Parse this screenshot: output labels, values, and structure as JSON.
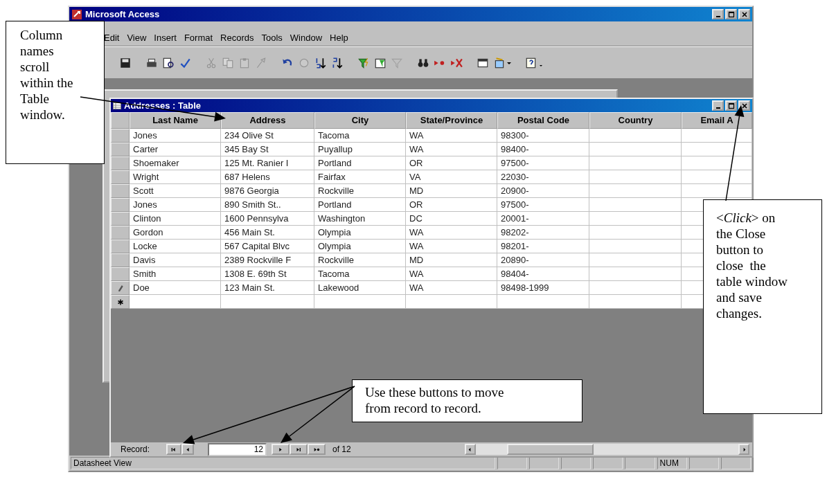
{
  "app_window": {
    "title": "Microsoft Access"
  },
  "menu_bar": [
    "Edit",
    "View",
    "Insert",
    "Format",
    "Records",
    "Tools",
    "Window",
    "Help"
  ],
  "table_window": {
    "title": "Addresses : Table",
    "columns": [
      "Last Name",
      "Address",
      "City",
      "State/Province",
      "Postal Code",
      "Country",
      "Email A"
    ],
    "rows": [
      {
        "kind": "record",
        "cells": [
          "Jones",
          "234 Olive St",
          "Tacoma",
          "WA",
          "98300-"
        ]
      },
      {
        "kind": "record",
        "cells": [
          "Carter",
          "345 Bay St",
          "Puyallup",
          "WA",
          "98400-"
        ]
      },
      {
        "kind": "record",
        "cells": [
          "Shoemaker",
          "125 Mt. Ranier I",
          "Portland",
          "OR",
          "97500-"
        ]
      },
      {
        "kind": "record",
        "cells": [
          "Wright",
          "687 Helens",
          "Fairfax",
          "VA",
          "22030-"
        ]
      },
      {
        "kind": "record",
        "cells": [
          "Scott",
          "9876 Georgia",
          "Rockville",
          "MD",
          "20900-"
        ]
      },
      {
        "kind": "record",
        "cells": [
          "Jones",
          "890 Smith St..",
          "Portland",
          "OR",
          "97500-"
        ]
      },
      {
        "kind": "record",
        "cells": [
          "Clinton",
          "1600 Pennsylva",
          "Washington",
          "DC",
          "20001-"
        ]
      },
      {
        "kind": "record",
        "cells": [
          "Gordon",
          "456 Main St.",
          "Olympia",
          "WA",
          "98202-"
        ]
      },
      {
        "kind": "record",
        "cells": [
          "Locke",
          "567 Capital Blvc",
          "Olympia",
          "WA",
          "98201-"
        ]
      },
      {
        "kind": "record",
        "cells": [
          "Davis",
          "2389 Rockville F",
          "Rockville",
          "MD",
          "20890-"
        ]
      },
      {
        "kind": "record",
        "cells": [
          "Smith",
          "1308 E. 69th St",
          "Tacoma",
          "WA",
          "98404-"
        ]
      },
      {
        "kind": "editing",
        "cells": [
          "Doe",
          "123 Main St.",
          "Lakewood",
          "WA",
          "98498-1999"
        ]
      },
      {
        "kind": "new"
      }
    ],
    "navigation": {
      "label": "Record:",
      "current": "12",
      "total": "of 12"
    }
  },
  "status_bar": {
    "text": "Datasheet View",
    "indicator": "NUM"
  },
  "callouts": {
    "column_note": "Column names scroll within the Table window.",
    "close_note": "<*Click*> on the Close button to close  the table window and save changes.",
    "navigation_note": "Use these buttons to move from record to record."
  }
}
